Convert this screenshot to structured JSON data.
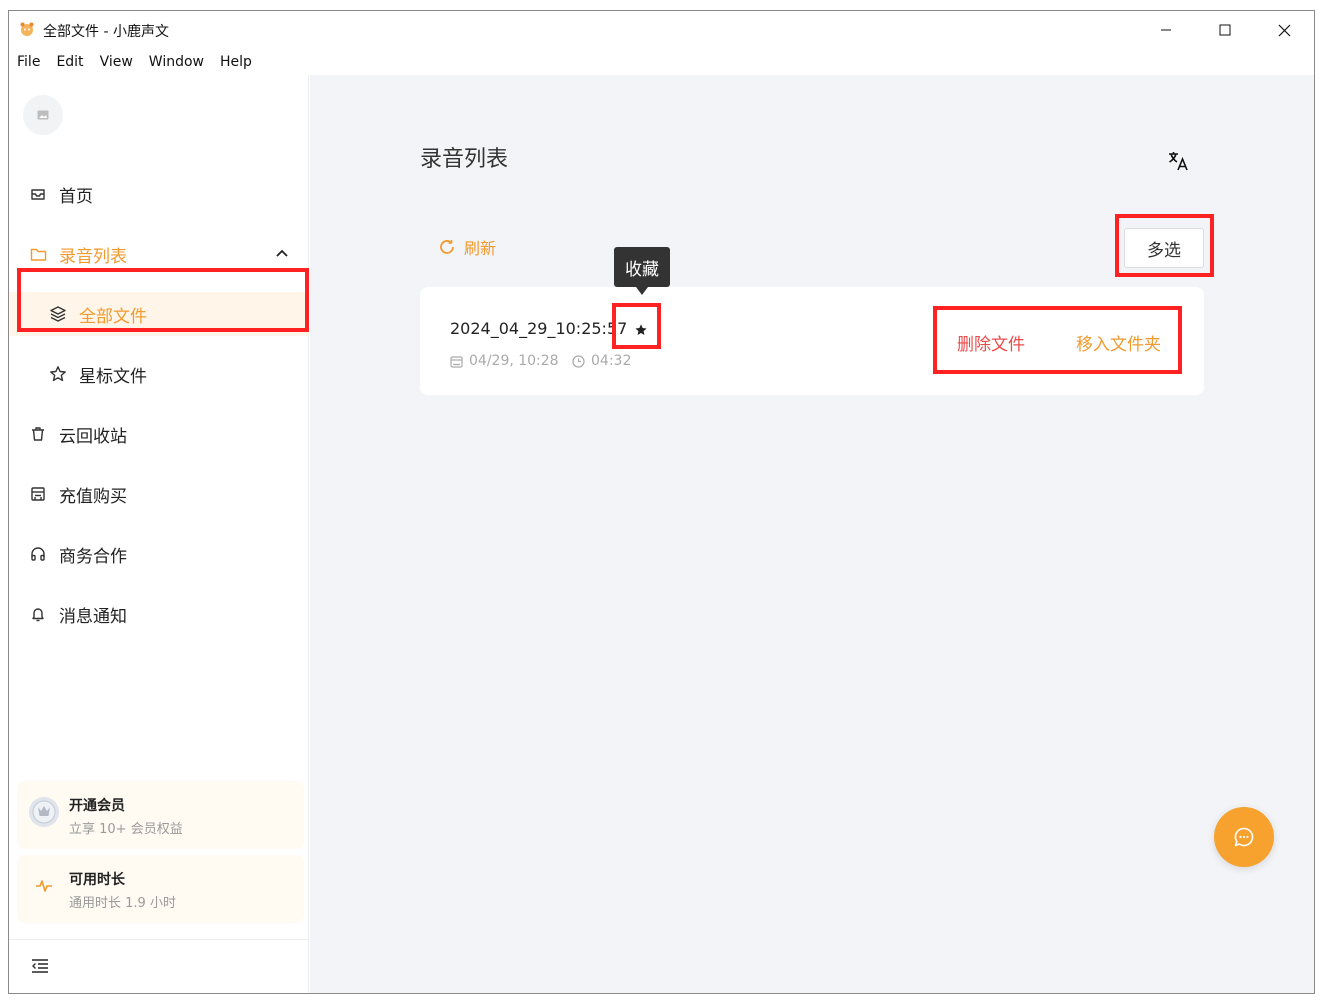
{
  "window": {
    "title": "全部文件 - 小鹿声文"
  },
  "menu": {
    "items": [
      "File",
      "Edit",
      "View",
      "Window",
      "Help"
    ]
  },
  "sidebar": {
    "items": [
      {
        "label": "首页",
        "icon": "inbox-icon"
      },
      {
        "label": "录音列表",
        "icon": "folder-icon"
      },
      {
        "label": "全部文件",
        "icon": "layers-icon"
      },
      {
        "label": "星标文件",
        "icon": "star-outline-icon"
      },
      {
        "label": "云回收站",
        "icon": "trash-icon"
      },
      {
        "label": "充值购买",
        "icon": "store-icon"
      },
      {
        "label": "商务合作",
        "icon": "headphones-icon"
      },
      {
        "label": "消息通知",
        "icon": "bell-icon"
      }
    ],
    "vip_card": {
      "title": "开通会员",
      "subtitle": "立享 10+ 会员权益"
    },
    "time_card": {
      "title": "可用时长",
      "subtitle": "通用时长 1.9 小时"
    }
  },
  "main": {
    "title": "录音列表",
    "refresh_label": "刷新",
    "multi_select_label": "多选",
    "tooltip": "收藏",
    "file": {
      "name": "2024_04_29_10:25:57",
      "date": "04/29, 10:28",
      "duration": "04:32",
      "delete_label": "删除文件",
      "move_label": "移入文件夹"
    }
  },
  "colors": {
    "accent": "#f19a2e",
    "danger": "#ea4b4b",
    "annotation": "#ff2222"
  }
}
